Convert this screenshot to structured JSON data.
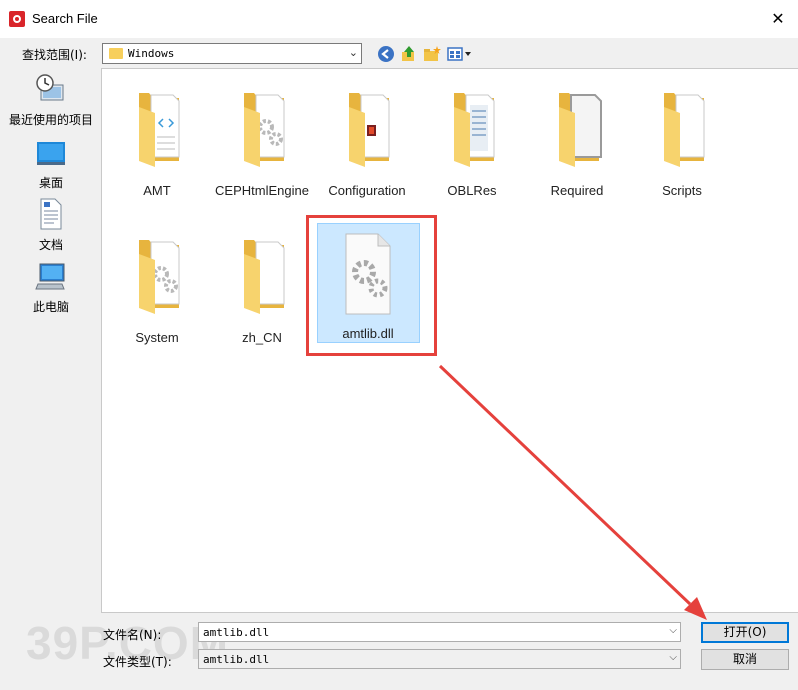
{
  "window": {
    "title": "Search File"
  },
  "toolbar": {
    "look_in_label": "查找范围(I):",
    "location": "Windows"
  },
  "places": [
    {
      "label": "最近使用的项目",
      "icon": "recent-items-icon"
    },
    {
      "label": "桌面",
      "icon": "desktop-icon"
    },
    {
      "label": "文档",
      "icon": "documents-icon"
    },
    {
      "label": "此电脑",
      "icon": "this-pc-icon"
    }
  ],
  "files": [
    {
      "name": "AMT",
      "type": "folder",
      "variant": "code"
    },
    {
      "name": "CEPHtmlEngine",
      "type": "folder",
      "variant": "gears"
    },
    {
      "name": "Configuration",
      "type": "folder",
      "variant": "adobe"
    },
    {
      "name": "OBLRes",
      "type": "folder",
      "variant": "docs"
    },
    {
      "name": "Required",
      "type": "folder",
      "variant": "rn"
    },
    {
      "name": "Scripts",
      "type": "folder",
      "variant": "plain"
    },
    {
      "name": "System",
      "type": "folder",
      "variant": "gears"
    },
    {
      "name": "zh_CN",
      "type": "folder",
      "variant": "plain"
    },
    {
      "name": "amtlib.dll",
      "type": "file",
      "variant": "dll",
      "selected": true
    }
  ],
  "bottom": {
    "filename_label": "文件名(N):",
    "filename_value": "amtlib.dll",
    "filetype_label": "文件类型(T):",
    "filetype_value": "amtlib.dll",
    "open_label": "打开(O)",
    "cancel_label": "取消"
  },
  "watermark": "39P.COM",
  "colors": {
    "annotation": "#e5413c",
    "selection": "#cce8ff",
    "folder": "#f7cf5c"
  }
}
